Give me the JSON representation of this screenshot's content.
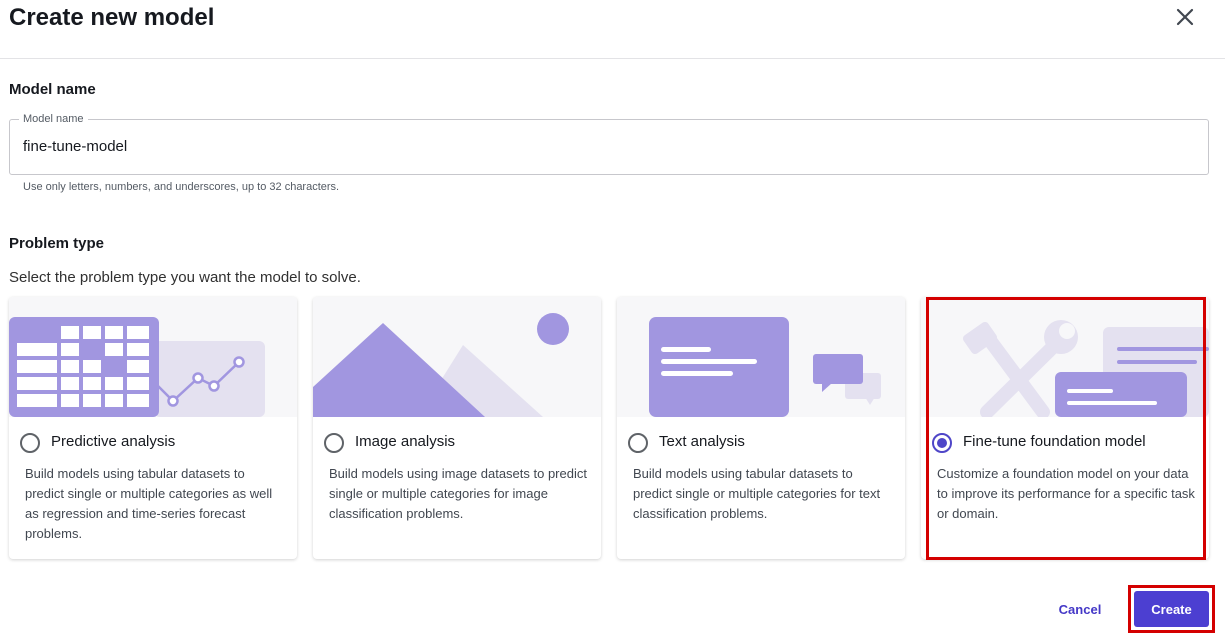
{
  "dialog": {
    "title": "Create new model",
    "close_icon": "close-icon"
  },
  "model_name": {
    "section_label": "Model name",
    "field_label": "Model name",
    "value": "fine-tune-model",
    "hint": "Use only letters, numbers, and underscores, up to 32 characters."
  },
  "problem_type": {
    "section_label": "Problem type",
    "description": "Select the problem type you want the model to solve.",
    "selected": "fine-tune",
    "cards": [
      {
        "id": "predictive",
        "title": "Predictive analysis",
        "description": "Build models using tabular datasets to predict single or multiple categories as well as regression and time-series forecast problems.",
        "icon": "table-chart-illustration",
        "selected": false
      },
      {
        "id": "image",
        "title": "Image analysis",
        "description": "Build models using image datasets to predict single or multiple categories for image classification problems.",
        "icon": "mountain-image-illustration",
        "selected": false
      },
      {
        "id": "text",
        "title": "Text analysis",
        "description": "Build models using tabular datasets to predict single or multiple categories for text classification problems.",
        "icon": "text-chat-illustration",
        "selected": false
      },
      {
        "id": "fine-tune",
        "title": "Fine-tune foundation model",
        "description": "Customize a foundation model on your data to improve its performance for a specific task or domain.",
        "icon": "tools-illustration",
        "selected": true
      }
    ]
  },
  "footer": {
    "cancel_label": "Cancel",
    "create_label": "Create"
  },
  "colors": {
    "accent": "#4c3fd1",
    "illustration_primary": "#a196e0",
    "illustration_secondary": "#e4e1f0",
    "highlight": "#d40000"
  }
}
